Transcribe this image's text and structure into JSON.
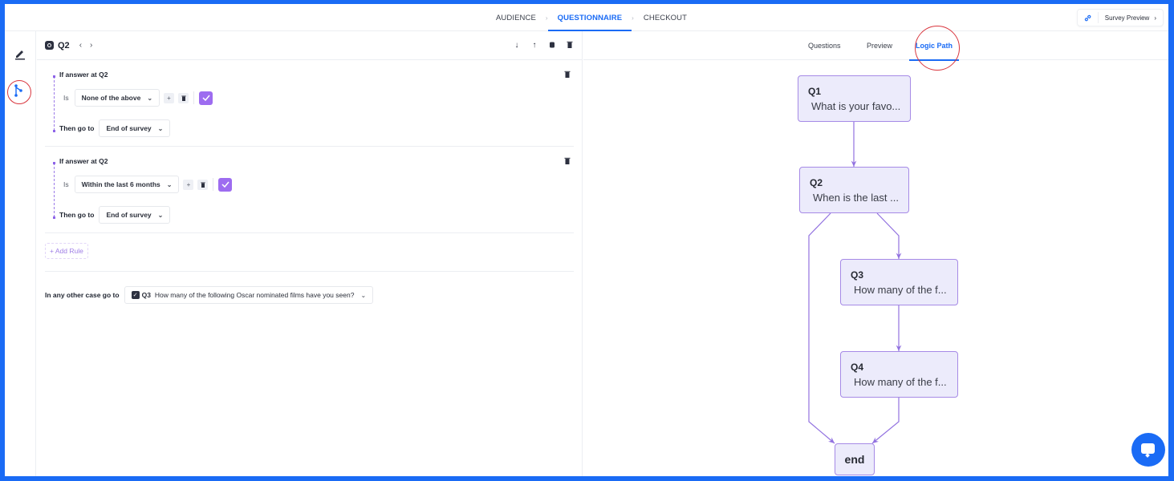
{
  "top_nav": {
    "steps": [
      {
        "label": "AUDIENCE",
        "active": false
      },
      {
        "label": "QUESTIONNAIRE",
        "active": true
      },
      {
        "label": "CHECKOUT",
        "active": false
      }
    ],
    "step_separator": "›",
    "survey_preview": {
      "icon": "link-icon",
      "label": "Survey Preview",
      "chevron": "›"
    }
  },
  "rail": {
    "items": [
      {
        "name": "edit",
        "icon": "pencil-icon"
      },
      {
        "name": "logic",
        "icon": "branch-icon",
        "highlighted": true
      }
    ]
  },
  "editor": {
    "question_id": "Q2",
    "prev_arrow": "‹",
    "next_arrow": "›",
    "actions": [
      {
        "name": "move-down",
        "glyph": "↓"
      },
      {
        "name": "move-up",
        "glyph": "↑"
      },
      {
        "name": "duplicate",
        "glyph": "⧉"
      },
      {
        "name": "delete",
        "glyph": "🗑"
      }
    ],
    "rules": [
      {
        "title": "If answer at Q2",
        "is_label": "Is",
        "answer": "None of the above",
        "then_label": "Then go to",
        "destination": "End of survey"
      },
      {
        "title": "If answer at Q2",
        "is_label": "Is",
        "answer": "Within the last 6 months",
        "then_label": "Then go to",
        "destination": "End of survey"
      }
    ],
    "add_rule_label": "+ Add Rule",
    "other_case": {
      "label": "In any other case go to",
      "question_id": "Q3",
      "question_text": "How many of the following Oscar nominated films have you seen?"
    },
    "accent_color": "#9d6cf0"
  },
  "right_panel": {
    "tabs": [
      {
        "label": "Questions",
        "active": false
      },
      {
        "label": "Preview",
        "active": false
      },
      {
        "label": "Logic Path",
        "active": true
      }
    ],
    "flow": {
      "nodes": [
        {
          "id": "Q1",
          "text": "What is your favo..."
        },
        {
          "id": "Q2",
          "text": "When is the last ..."
        },
        {
          "id": "Q3",
          "text": "How many of the f..."
        },
        {
          "id": "Q4",
          "text": "How many of the f..."
        },
        {
          "id": "end",
          "text": "end"
        }
      ],
      "edges": [
        {
          "from": "Q1",
          "to": "Q2"
        },
        {
          "from": "Q2",
          "to": "Q3"
        },
        {
          "from": "Q3",
          "to": "Q4"
        },
        {
          "from": "Q2",
          "to": "end"
        },
        {
          "from": "Q4",
          "to": "end"
        }
      ]
    }
  },
  "chat_widget": {
    "icon": "chat-icon"
  },
  "colors": {
    "brand_blue": "#1a6bf5",
    "node_fill": "#ecebfb",
    "node_border": "#a68ae6",
    "highlight_red": "#d9363e"
  }
}
